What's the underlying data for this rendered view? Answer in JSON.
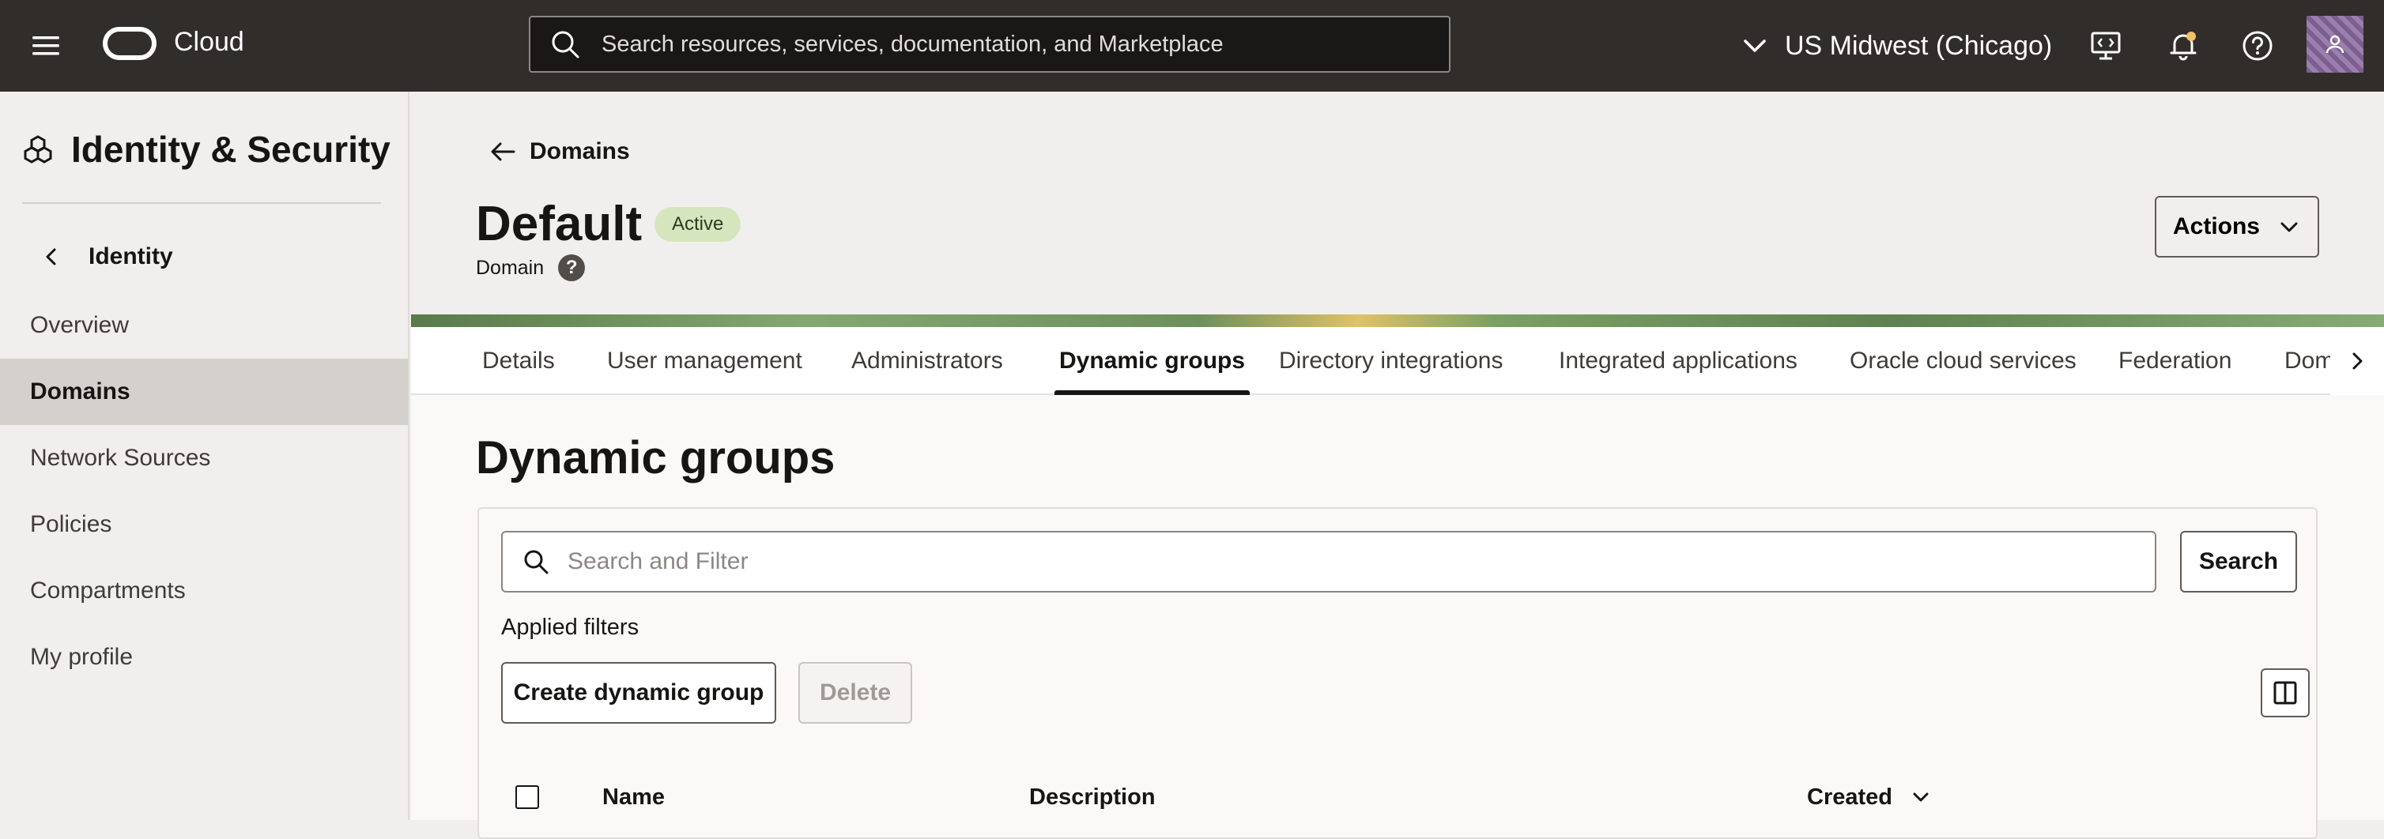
{
  "topbar": {
    "brand": "Cloud",
    "search_placeholder": "Search resources, services, documentation, and Marketplace",
    "region": "US Midwest (Chicago)",
    "icons": [
      "menu-icon",
      "oracle-logo",
      "search-icon",
      "chevron-down-icon",
      "developer-tools-icon",
      "notification-bell-icon",
      "help-icon",
      "user-avatar"
    ]
  },
  "sidebar": {
    "title": "Identity & Security",
    "back_label": "Identity",
    "items": [
      {
        "label": "Overview",
        "active": false
      },
      {
        "label": "Domains",
        "active": true
      },
      {
        "label": "Network Sources",
        "active": false
      },
      {
        "label": "Policies",
        "active": false
      },
      {
        "label": "Compartments",
        "active": false
      },
      {
        "label": "My profile",
        "active": false
      }
    ]
  },
  "header": {
    "back_label": "Domains",
    "title": "Default",
    "status": "Active",
    "subtitle": "Domain",
    "help": "?",
    "actions_label": "Actions"
  },
  "tabs": [
    {
      "label": "Details",
      "active": false
    },
    {
      "label": "User management",
      "active": false
    },
    {
      "label": "Administrators",
      "active": false
    },
    {
      "label": "Dynamic groups",
      "active": true
    },
    {
      "label": "Directory integrations",
      "active": false
    },
    {
      "label": "Integrated applications",
      "active": false
    },
    {
      "label": "Oracle cloud services",
      "active": false
    },
    {
      "label": "Federation",
      "active": false
    },
    {
      "label": "Dom",
      "active": false
    }
  ],
  "section": {
    "title": "Dynamic groups",
    "filter_placeholder": "Search and Filter",
    "search_button": "Search",
    "applied_filters_label": "Applied filters",
    "create_button": "Create dynamic group",
    "delete_button": "Delete",
    "columns": [
      "Name",
      "Description",
      "Created"
    ]
  },
  "colors": {
    "topbar_bg": "#312d2a",
    "active_badge": "#d5e6be",
    "active_nav": "#d4d1cd"
  }
}
